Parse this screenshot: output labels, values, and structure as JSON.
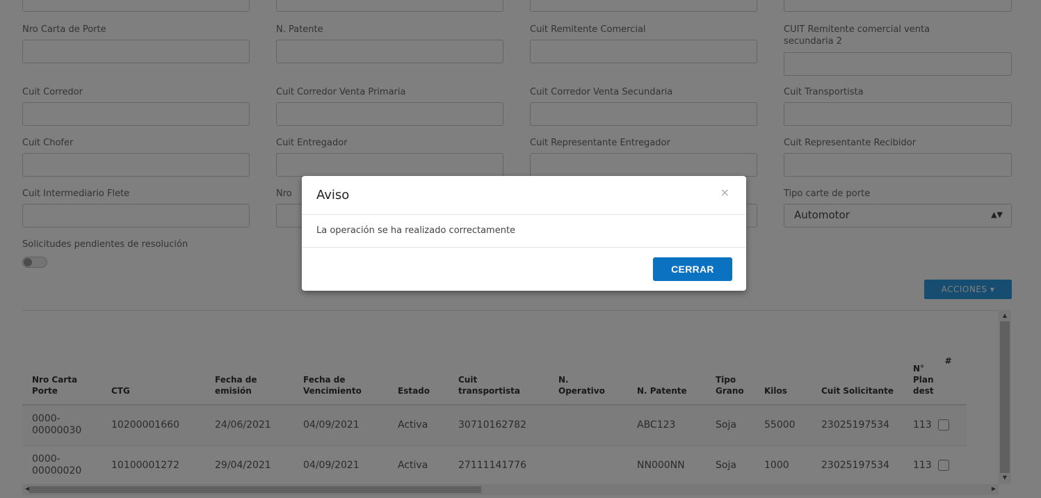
{
  "form": {
    "row1": [
      {
        "label": "Nro Carta de Porte"
      },
      {
        "label": "N. Patente"
      },
      {
        "label": "Cuit Remitente Comercial"
      },
      {
        "label": "CUIT Remitente comercial venta secundaria 2"
      }
    ],
    "row2": [
      {
        "label": "Cuit Corredor"
      },
      {
        "label": "Cuit Corredor Venta Primaria"
      },
      {
        "label": "Cuit Corredor Venta Secundaria"
      },
      {
        "label": "Cuit Transportista"
      }
    ],
    "row3": [
      {
        "label": "Cuit Chofer"
      },
      {
        "label": "Cuit Entregador"
      },
      {
        "label": "Cuit Representante Entregador"
      },
      {
        "label": "Cuit Representante Recibidor"
      }
    ],
    "row4": [
      {
        "label": "Cuit Intermediario Flete"
      },
      {
        "label": "Nro"
      },
      {
        "label": "Tipo carte de porte",
        "value": "Automotor"
      }
    ],
    "pending_label": "Solicitudes pendientes de resolución",
    "pending_toggle_on": false
  },
  "actions": {
    "label": "ACCIONES ▾"
  },
  "table": {
    "headers": [
      "Nro Carta Porte",
      "CTG",
      "Fecha de emisión",
      "Fecha de Vencimiento",
      "Estado",
      "Cuit transportista",
      "N. Operativo",
      "N. Patente",
      "Tipo Grano",
      "Kilos",
      "Cuit Solicitante",
      "N° Plan dest",
      "#"
    ],
    "rows": [
      [
        "0000-00000030",
        "10200001660",
        "24/06/2021",
        "04/09/2021",
        "Activa",
        "30710162782",
        "",
        "ABC123",
        "Soja",
        "55000",
        "23025197534",
        "113"
      ],
      [
        "0000-00000020",
        "10100001272",
        "29/04/2021",
        "04/09/2021",
        "Activa",
        "27111141776",
        "",
        "NN000NN",
        "Soja",
        "1000",
        "23025197534",
        "113"
      ]
    ]
  },
  "modal": {
    "title": "Aviso",
    "close_symbol": "×",
    "message": "La operación se ha realizado correctamente",
    "button_label": "CERRAR"
  }
}
